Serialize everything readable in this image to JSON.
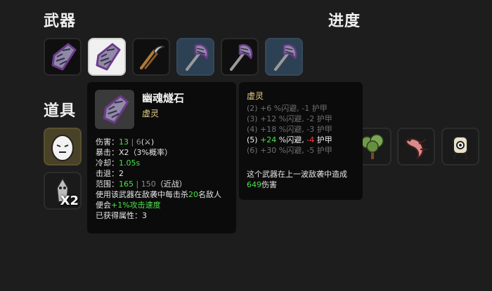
{
  "headings": {
    "weapons": "武器",
    "progress": "进度",
    "items": "道具"
  },
  "weapons": [
    {
      "icon": "ghost-flint-icon",
      "state": "normal"
    },
    {
      "icon": "ghost-flint-icon",
      "state": "selected"
    },
    {
      "icon": "sickle-icon",
      "state": "normal"
    },
    {
      "icon": "ghost-axe-icon",
      "state": "tier2"
    },
    {
      "icon": "ghost-axe-icon",
      "state": "normal"
    },
    {
      "icon": "ghost-axe-icon",
      "state": "tier2"
    }
  ],
  "items": [
    {
      "icon": "egg-face-icon",
      "count": ""
    },
    {
      "icon": "alien-figure-icon",
      "count": "X2"
    },
    {
      "icon": "tree-icon",
      "count": ""
    },
    {
      "icon": "pink-lizard-icon",
      "count": ""
    },
    {
      "icon": "robot-eye-icon",
      "count": ""
    }
  ],
  "tooltip": {
    "name": "幽魂燧石",
    "type": "虚灵",
    "damage_label": "伤害：",
    "damage_value": "13",
    "damage_base": "6",
    "crit_label": "暴击：",
    "crit_value": "X2（3%概率）",
    "cooldown_label": "冷却：",
    "cooldown_value": "1.05s",
    "knockback_label": "击退：",
    "knockback_value": "2",
    "range_label": "范围：",
    "range_value": "165",
    "range_base": "150",
    "range_suffix": "（近战）",
    "desc_1": "使用该武器在敌袭中每击杀",
    "desc_num": "20",
    "desc_2": "名敌人",
    "desc_3": "便会",
    "desc_bonus": "+1%攻击速度",
    "gained_label": "已获得属性：",
    "gained_value": "3"
  },
  "set_tooltip": {
    "title": "虚灵",
    "tiers": [
      {
        "text": "(2) +6 %闪避, -1 护甲",
        "active": false
      },
      {
        "text": "(3) +12 %闪避, -2 护甲",
        "active": false
      },
      {
        "text": "(4) +18 %闪避, -3 护甲",
        "active": false
      },
      {
        "prefix": "(5) ",
        "bonus": "+24",
        "mid": " %闪避, ",
        "malus": "-4",
        "suffix": " 护甲",
        "active": true
      },
      {
        "text": "(6) +30 %闪避, -5 护甲",
        "active": false
      }
    ],
    "damage_line_1": "这个武器在上一波敌袭中造成",
    "damage_value": "649",
    "damage_line_2": "伤害"
  },
  "colors": {
    "positive": "#4be24b",
    "negative": "#ff4040",
    "set_title": "#e8d28a",
    "tier2_bg": "#2d4154"
  }
}
